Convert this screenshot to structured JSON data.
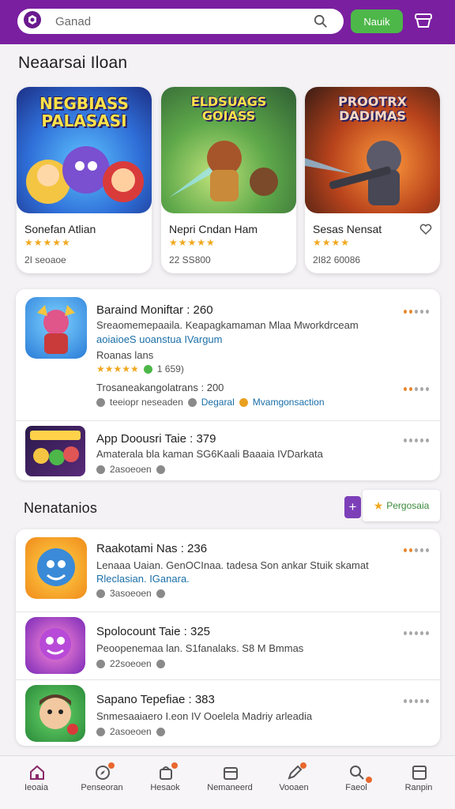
{
  "header": {
    "search_placeholder": "Ganad",
    "action_label": "Nauik"
  },
  "featured": {
    "title": "Neaarsai Iloan",
    "cards": [
      {
        "art_title": "NEGBIASS PALASASI",
        "name": "Sonefan Atlian",
        "stars": "★★★★★",
        "meta": "2I seoaoe"
      },
      {
        "art_title": "ELDSUAGS GOIASS",
        "name": "Nepri Cndan Ham",
        "stars": "★★★★★",
        "meta": "22 SS800"
      },
      {
        "art_title": "PROOTRX DADIMAS",
        "name": "Sesas Nensat",
        "stars": "★★★★",
        "meta": "2I82 60086"
      }
    ]
  },
  "list_one": [
    {
      "title": "Baraind Moniftar : 260",
      "desc": "Sreaomemepaaila. Keapagkamaman Mlaa Mworkdrceam",
      "link": "aoiaioeS uoanstua IVargum",
      "sub": "Roanas lans",
      "rating_stars": "★★★★★",
      "rating": "1 659)",
      "desc2": "Trosaneakangolatrans : 200",
      "meta_a": "teeiopr neseaden",
      "meta_b": "Degaral",
      "meta_c": "Mvamgonsaction"
    },
    {
      "title": "App Doousri Taie : 379",
      "desc": "Amaterala bla kaman SG6Kaali Baaaia IVDarkata",
      "meta": "2asoeoen"
    }
  ],
  "section2": {
    "title": "Nenatanios",
    "plus_label": "+",
    "promo_label": "Pergosaia"
  },
  "list_two": [
    {
      "title": "Raakotami Nas : 236",
      "desc": "Lenaaa Uaian. GenOCInaa. tadesa Son ankar Stuik skamat",
      "link": "Rleclasian. IGanara.",
      "meta": "3asoeoen"
    },
    {
      "title": "Spolocount Taie : 325",
      "desc": "Peoopenemaa lan. S1fanalaks. S8 M Bmmas",
      "meta": "22soeoen"
    },
    {
      "title": "Sapano Tepefiae : 383",
      "desc": "Snmesaaiaero I.eon IV Ooelela Madriy arleadia",
      "meta": "2asoeoen"
    }
  ],
  "nav": [
    {
      "label": "Ieoaia"
    },
    {
      "label": "Penseoran"
    },
    {
      "label": "Hesaok"
    },
    {
      "label": "Nemaneerd"
    },
    {
      "label": "Vooaen"
    },
    {
      "label": "Faeol"
    },
    {
      "label": "Ranpin"
    }
  ],
  "colors": {
    "header": "#7a1fa0",
    "action": "#4db749",
    "star": "#f0a820",
    "link": "#1a6fa8"
  }
}
